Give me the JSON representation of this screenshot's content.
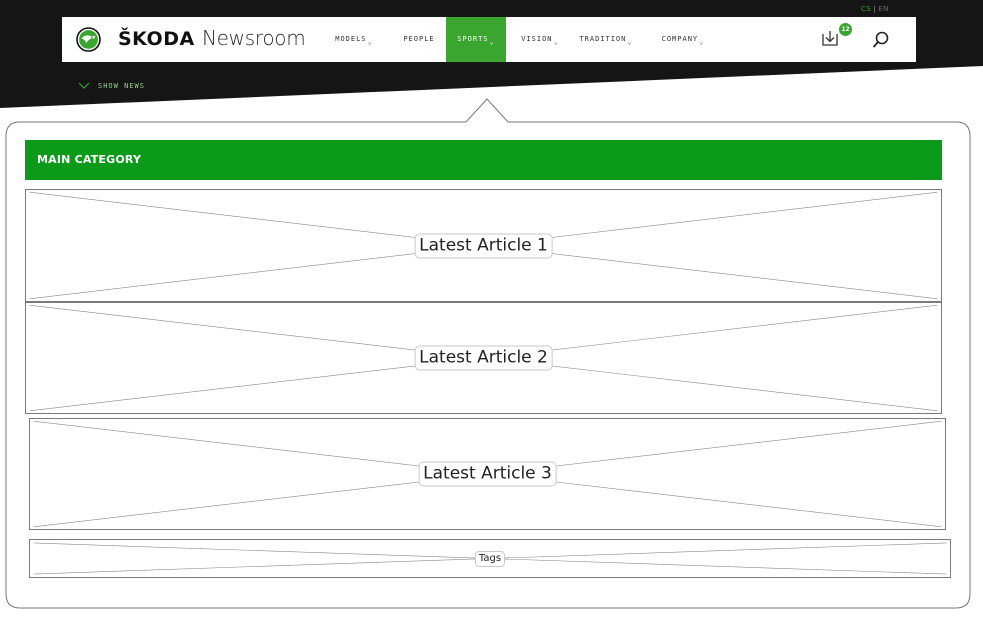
{
  "header": {
    "brand": {
      "wordmark": "ŠKODA",
      "product": "Newsroom",
      "logo_icon": "skoda-winged-arrow-logo"
    },
    "language": {
      "current": "CS",
      "separator": "|",
      "other": "EN"
    },
    "nav": [
      {
        "label": "MODELS",
        "has_dropdown": true,
        "active": false
      },
      {
        "label": "PEOPLE",
        "has_dropdown": false,
        "active": false
      },
      {
        "label": "SPORTS",
        "has_dropdown": true,
        "active": true
      },
      {
        "label": "VISION",
        "has_dropdown": true,
        "active": false
      },
      {
        "label": "TRADITION",
        "has_dropdown": true,
        "active": false
      },
      {
        "label": "COMPANY",
        "has_dropdown": true,
        "active": false
      }
    ],
    "chevron_glyph": "⌄",
    "downloads": {
      "icon": "download-icon",
      "badge_count": "12"
    },
    "search": {
      "icon": "search-icon"
    },
    "show_news": "SHOW NEWS"
  },
  "dropdown": {
    "main_category": "MAIN CATEGORY",
    "articles": [
      "Latest Article 1",
      "Latest Article 2",
      "Latest Article 3"
    ],
    "tags_label": "Tags"
  },
  "colors": {
    "header_dark": "#151515",
    "brand_green": "#0b9a1a",
    "nav_active_green": "#3aa52f",
    "placeholder_line": "#7a7a7a"
  }
}
